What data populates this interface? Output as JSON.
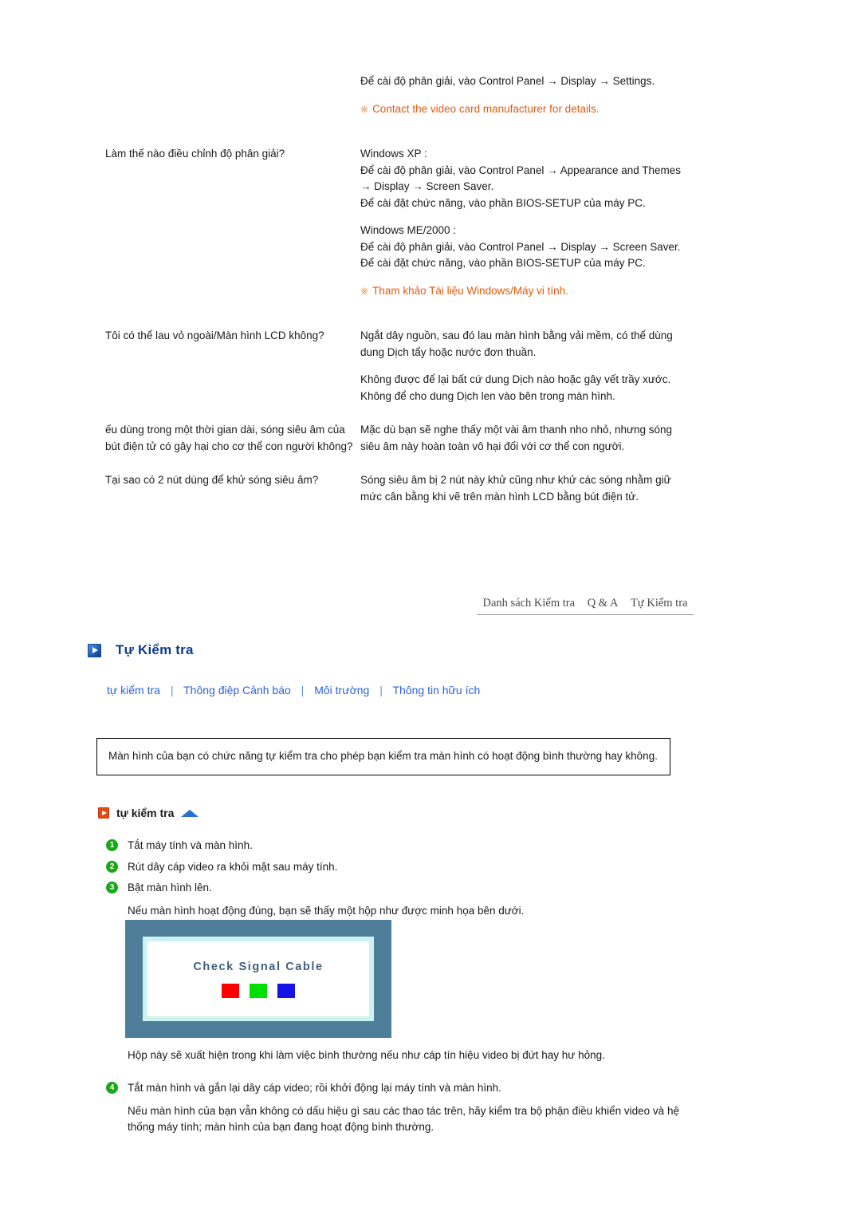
{
  "faq": {
    "rows": [
      {
        "question": "",
        "answer_paragraphs": [
          "Để cài độ phân giải, vào Control Panel → Display → Settings."
        ],
        "note": "Contact the video card manufacturer for details.",
        "note_mark": "※"
      },
      {
        "question": "Làm thế nào điều chỉnh độ phân giải?",
        "answer_paragraphs": [
          "Windows XP :\nĐể cài độ phân giải, vào Control Panel → Appearance and Themes → Display → Screen Saver.\nĐể cài đặt chức năng, vào phần BIOS-SETUP của máy PC.",
          "Windows ME/2000 :\nĐể cài độ phân giải, vào Control Panel → Display → Screen Saver.\nĐể cài đặt chức năng, vào phần BIOS-SETUP của máy PC."
        ],
        "note": "Tham khảo Tài liệu Windows/Máy vi tính.",
        "note_mark": "※"
      },
      {
        "question": "Tôi có thể lau vỏ ngoài/Màn hình LCD không?",
        "answer_paragraphs": [
          "Ngắt dây nguồn, sau đó lau màn hình bằng vải mềm, có thể dùng dung Dịch tẩy hoặc nước đơn thuần.",
          "Không được để lại bất cứ dung Dịch nào hoặc gây vết trầy xước. Không để cho dung Dịch len vào bên trong màn hình."
        ],
        "note": "",
        "note_mark": ""
      },
      {
        "question": "ếu dùng trong một thời gian dài, sóng siêu âm của bút điện tử có gây hại cho cơ thể con người không?",
        "answer_paragraphs": [
          "Mặc dù bạn sẽ nghe thấy một vài âm thanh nho nhỏ, nhưng sóng siêu âm này hoàn toàn vô hại đối với cơ thể con người."
        ],
        "note": "",
        "note_mark": ""
      },
      {
        "question": "Tại sao có 2 nút dùng để khử sóng siêu âm?",
        "answer_paragraphs": [
          "Sóng siêu âm bị 2 nút này khử cũng như khử các sóng nhằm giữ mức cân bằng khi vẽ trên màn hình LCD bằng bút điện tử."
        ],
        "note": "",
        "note_mark": ""
      }
    ]
  },
  "breadcrumb": {
    "items": [
      "Danh sách Kiểm tra",
      "Q & A",
      "Tự Kiểm tra"
    ]
  },
  "section": {
    "title": "Tự Kiểm tra",
    "icon": "blue-play-icon"
  },
  "sublinks": {
    "items": [
      "tự kiểm tra",
      "Thông điệp Cảnh báo",
      "Môi trường",
      "Thông tin hữu ích"
    ],
    "separator": "|"
  },
  "intro": {
    "text": "Màn hình của bạn có chức năng tự kiểm tra cho phép bạn kiểm tra màn hình có hoạt động bình thường hay không."
  },
  "subsection": {
    "title": "tự kiểm tra",
    "icon": "red-play-icon",
    "up_arrow_icon": "up-triangle-icon"
  },
  "steps": {
    "items": [
      {
        "num": "1",
        "text": "Tắt máy tính và màn hình."
      },
      {
        "num": "2",
        "text": "Rút dây cáp video ra khỏi mặt sau máy tính."
      },
      {
        "num": "3",
        "text": "Bật màn hình lên."
      }
    ],
    "after_step3_note": "Nếu màn hình hoạt động đúng, bạn sẽ thấy một hộp như được minh họa bên dưới."
  },
  "monitor": {
    "message": "Check Signal Cable",
    "swatches": [
      {
        "name": "red-swatch",
        "color": "#ff0000"
      },
      {
        "name": "green-swatch",
        "color": "#00e000"
      },
      {
        "name": "blue-swatch",
        "color": "#1414e6"
      }
    ],
    "frame_color": "#4f7e9b",
    "inner_border_color": "#cdf2f2",
    "text_color": "#3f5f80"
  },
  "tail": {
    "lead": "Hộp này sẽ xuất hiện trong khi làm việc bình thường nếu như cáp tín hiệu video bị đứt hay hư hỏng.",
    "step4": {
      "num": "4",
      "text": "Tắt màn hình và gắn lại dây cáp video; rồi khởi động lại máy tính và màn hình."
    },
    "closing": "Nếu màn hình của bạn vẫn không có dấu hiệu gì sau các thao tác trên, hãy kiểm tra bộ phận điều khiển video và hệ thống máy tính; màn hình của bạn đang hoạt động bình thường."
  },
  "colors": {
    "note_orange": "#e8590c",
    "heading_blue": "#0b3c8c",
    "link_blue": "#2c62e0",
    "step_green": "#18a818"
  }
}
